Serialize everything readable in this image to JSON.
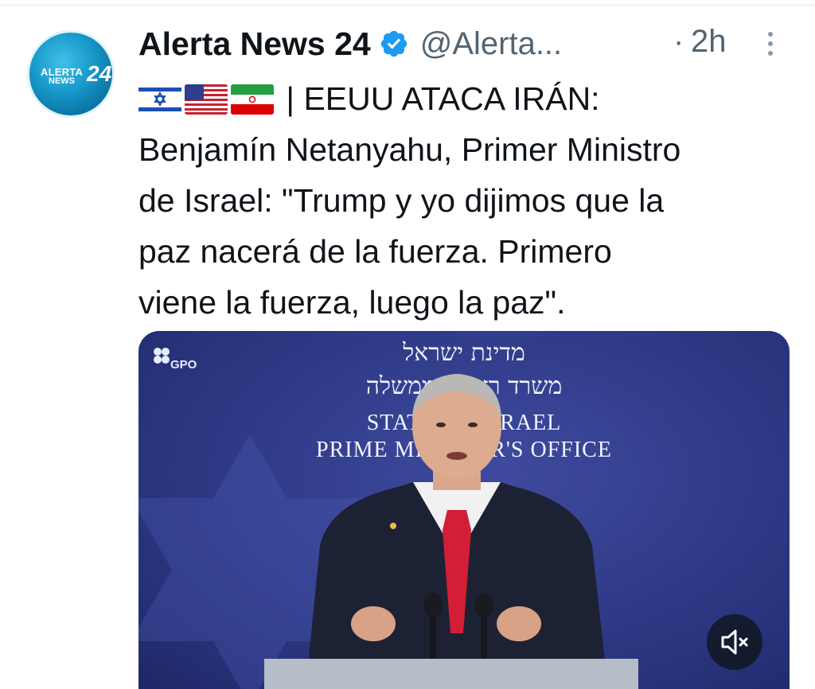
{
  "account": {
    "name": "Alerta News 24",
    "handle": "@Alerta...",
    "separator": "·",
    "time": "2h",
    "avatar_text_top": "ALERTA",
    "avatar_text_bottom": "NEWS",
    "avatar_number": "24"
  },
  "tweet": {
    "flags": [
      "israel-flag-icon",
      "usa-flag-icon",
      "iran-flag-icon"
    ],
    "lines": [
      "| EEUU ATACA IRÁN:",
      "Benjamín Netanyahu, Primer Ministro",
      "de Israel: \"Trump y yo dijimos que la",
      "paz nacerá de la fuerza. Primero",
      "viene la fuerza, luego la paz\"."
    ]
  },
  "media": {
    "watermark": "GPO",
    "hebrew_line_1": "מדינת ישראל",
    "hebrew_line_2": "משרד ראש הממשלה",
    "english_line_1": "STATE OF ISRAEL",
    "english_line_2": "PRIME MINISTER'S OFFICE",
    "mute_icon": "speaker-muted-icon"
  },
  "colors": {
    "text": "#0f1419",
    "secondary": "#536471",
    "verified": "#1d9bf0",
    "media_bg": "#323e8c"
  }
}
